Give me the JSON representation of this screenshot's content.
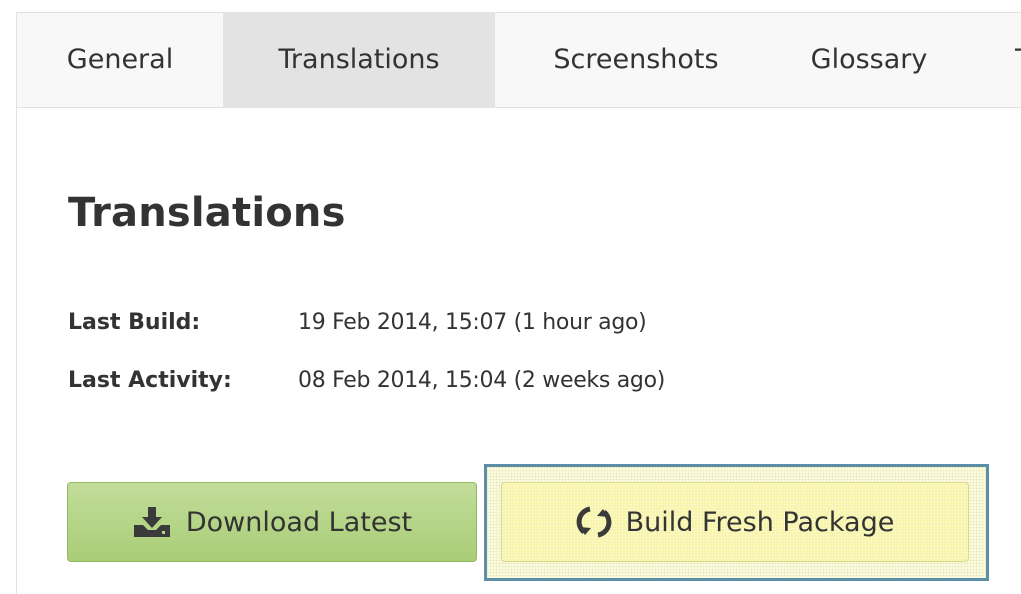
{
  "tabs": {
    "general": "General",
    "translations": "Translations",
    "screenshots": "Screenshots",
    "glossary": "Glossary",
    "more_partial": "T"
  },
  "active_tab": "Translations",
  "page": {
    "title": "Translations"
  },
  "meta": {
    "last_build_label": "Last Build:",
    "last_build_value": "19 Feb 2014, 15:07 (1 hour ago)",
    "last_activity_label": "Last Activity:",
    "last_activity_value": "08 Feb 2014, 15:04 (2 weeks ago)"
  },
  "buttons": {
    "download_label": "Download Latest",
    "download_icon": "download-icon",
    "build_label": "Build Fresh Package",
    "build_icon": "refresh-icon"
  },
  "colors": {
    "download_button": "#b5d588",
    "build_button": "#f7f4a7",
    "highlight_border": "#5b8fa8",
    "active_tab": "#e3e3e3"
  }
}
